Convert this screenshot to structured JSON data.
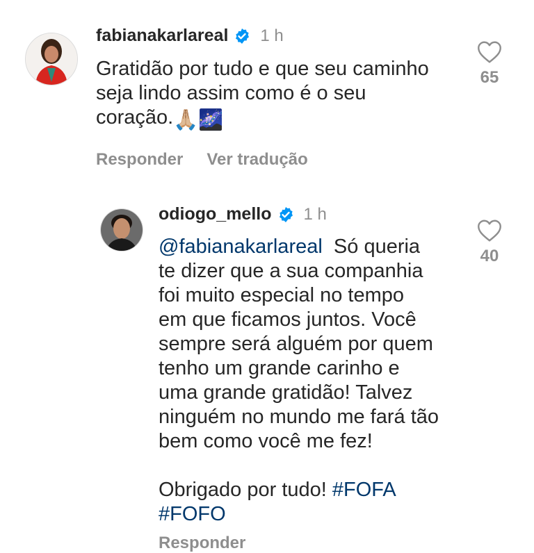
{
  "comments": [
    {
      "username": "fabianakarlareal",
      "time": "1 h",
      "text": "Gratidão por tudo e que seu caminho\nseja lindo assim como é o seu\ncoração.",
      "emoji": "🙏🏼🌌",
      "likes": "65",
      "actions": [
        "Responder",
        "Ver tradução"
      ]
    },
    {
      "username": "odiogo_mello",
      "time": "1 h",
      "mention": "@fabianakarlareal",
      "text": "  Só queria\nte dizer que a sua companhia\nfoi muito especial no tempo\nem que ficamos juntos. Você\nsempre será alguém por quem\ntenho um grande carinho e\numa grande gratidão! Talvez\nninguém no mundo me fará tão\nbem como você me fez!\n\nObrigado por tudo! ",
      "hashtags": [
        "#FOFA",
        "#FOFO"
      ],
      "likes": "40",
      "actions": [
        "Responder"
      ]
    }
  ],
  "icons": {
    "verified": "verified-badge-icon",
    "like": "heart-outline-icon"
  },
  "colors": {
    "link": "#00376b",
    "verified": "#0095f6",
    "muted": "#8e8e8e"
  }
}
